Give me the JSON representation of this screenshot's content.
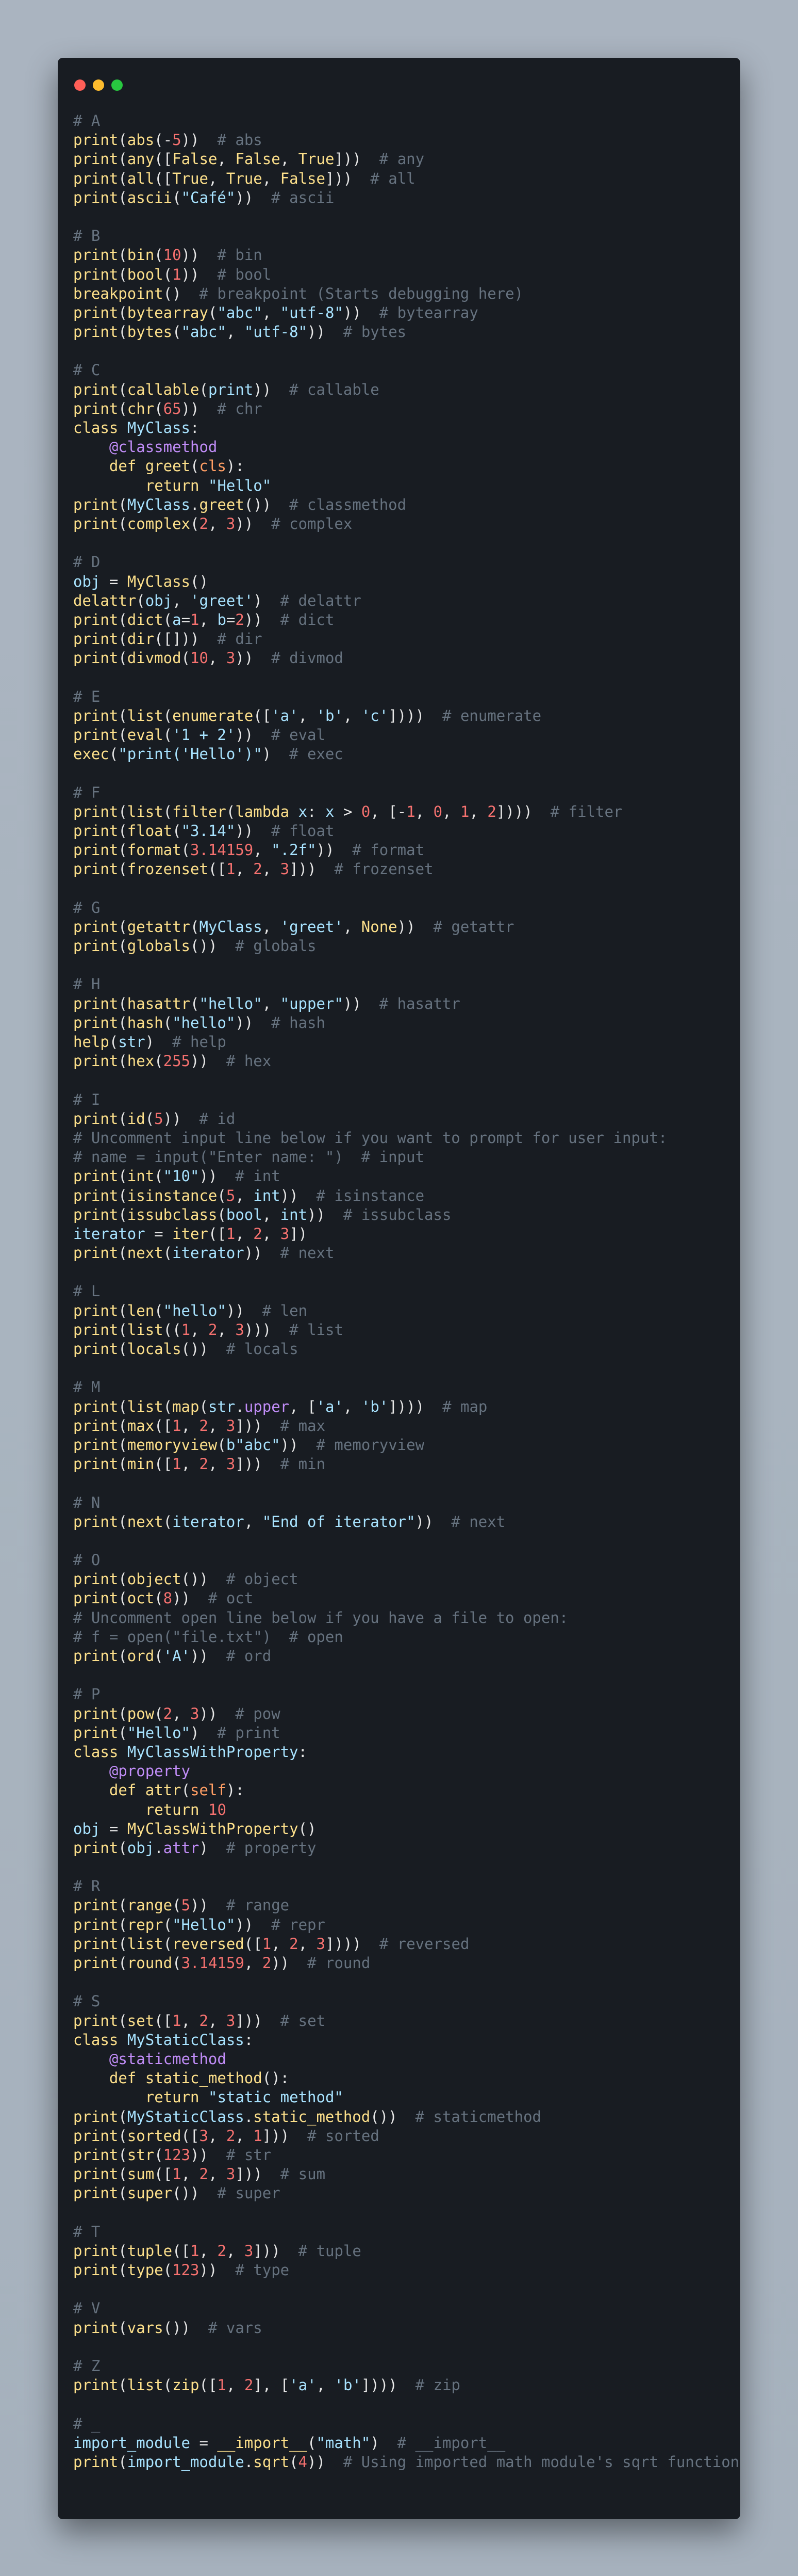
{
  "window": {
    "controls": {
      "close": "#ff5f57",
      "minimize": "#febc2e",
      "zoom": "#28c840"
    },
    "background": "#181c22"
  },
  "code_lines": [
    "# A",
    "print(abs(-5))  # abs",
    "print(any([False, False, True]))  # any",
    "print(all([True, True, False]))  # all",
    "print(ascii(\"Café\"))  # ascii",
    "",
    "# B",
    "print(bin(10))  # bin",
    "print(bool(1))  # bool",
    "breakpoint()  # breakpoint (Starts debugging here)",
    "print(bytearray(\"abc\", \"utf-8\"))  # bytearray",
    "print(bytes(\"abc\", \"utf-8\"))  # bytes",
    "",
    "# C",
    "print(callable(print))  # callable",
    "print(chr(65))  # chr",
    "class MyClass:",
    "    @classmethod",
    "    def greet(cls):",
    "        return \"Hello\"",
    "print(MyClass.greet())  # classmethod",
    "print(complex(2, 3))  # complex",
    "",
    "# D",
    "obj = MyClass()",
    "delattr(obj, 'greet')  # delattr",
    "print(dict(a=1, b=2))  # dict",
    "print(dir([]))  # dir",
    "print(divmod(10, 3))  # divmod",
    "",
    "# E",
    "print(list(enumerate(['a', 'b', 'c'])))  # enumerate",
    "print(eval('1 + 2'))  # eval",
    "exec(\"print('Hello')\")  # exec",
    "",
    "# F",
    "print(list(filter(lambda x: x > 0, [-1, 0, 1, 2])))  # filter",
    "print(float(\"3.14\"))  # float",
    "print(format(3.14159, \".2f\"))  # format",
    "print(frozenset([1, 2, 3]))  # frozenset",
    "",
    "# G",
    "print(getattr(MyClass, 'greet', None))  # getattr",
    "print(globals())  # globals",
    "",
    "# H",
    "print(hasattr(\"hello\", \"upper\"))  # hasattr",
    "print(hash(\"hello\"))  # hash",
    "help(str)  # help",
    "print(hex(255))  # hex",
    "",
    "# I",
    "print(id(5))  # id",
    "# Uncomment input line below if you want to prompt for user input:",
    "# name = input(\"Enter name: \")  # input",
    "print(int(\"10\"))  # int",
    "print(isinstance(5, int))  # isinstance",
    "print(issubclass(bool, int))  # issubclass",
    "iterator = iter([1, 2, 3])",
    "print(next(iterator))  # next",
    "",
    "# L",
    "print(len(\"hello\"))  # len",
    "print(list((1, 2, 3)))  # list",
    "print(locals())  # locals",
    "",
    "# M",
    "print(list(map(str.upper, ['a', 'b'])))  # map",
    "print(max([1, 2, 3]))  # max",
    "print(memoryview(b\"abc\"))  # memoryview",
    "print(min([1, 2, 3]))  # min",
    "",
    "# N",
    "print(next(iterator, \"End of iterator\"))  # next",
    "",
    "# O",
    "print(object())  # object",
    "print(oct(8))  # oct",
    "# Uncomment open line below if you have a file to open:",
    "# f = open(\"file.txt\")  # open",
    "print(ord('A'))  # ord",
    "",
    "# P",
    "print(pow(2, 3))  # pow",
    "print(\"Hello\")  # print",
    "class MyClassWithProperty:",
    "    @property",
    "    def attr(self):",
    "        return 10",
    "obj = MyClassWithProperty()",
    "print(obj.attr)  # property",
    "",
    "# R",
    "print(range(5))  # range",
    "print(repr(\"Hello\"))  # repr",
    "print(list(reversed([1, 2, 3])))  # reversed",
    "print(round(3.14159, 2))  # round",
    "",
    "# S",
    "print(set([1, 2, 3]))  # set",
    "class MyStaticClass:",
    "    @staticmethod",
    "    def static_method():",
    "        return \"static method\"",
    "print(MyStaticClass.static_method())  # staticmethod",
    "print(sorted([3, 2, 1]))  # sorted",
    "print(str(123))  # str",
    "print(sum([1, 2, 3]))  # sum",
    "print(super())  # super",
    "",
    "# T",
    "print(tuple([1, 2, 3]))  # tuple",
    "print(type(123))  # type",
    "",
    "# V",
    "print(vars())  # vars",
    "",
    "# Z",
    "print(list(zip([1, 2], ['a', 'b'])))  # zip",
    "",
    "# _",
    "import_module = __import__(\"math\")  # __import__",
    "print(import_module.sqrt(4))  # Using imported math module's sqrt function"
  ]
}
